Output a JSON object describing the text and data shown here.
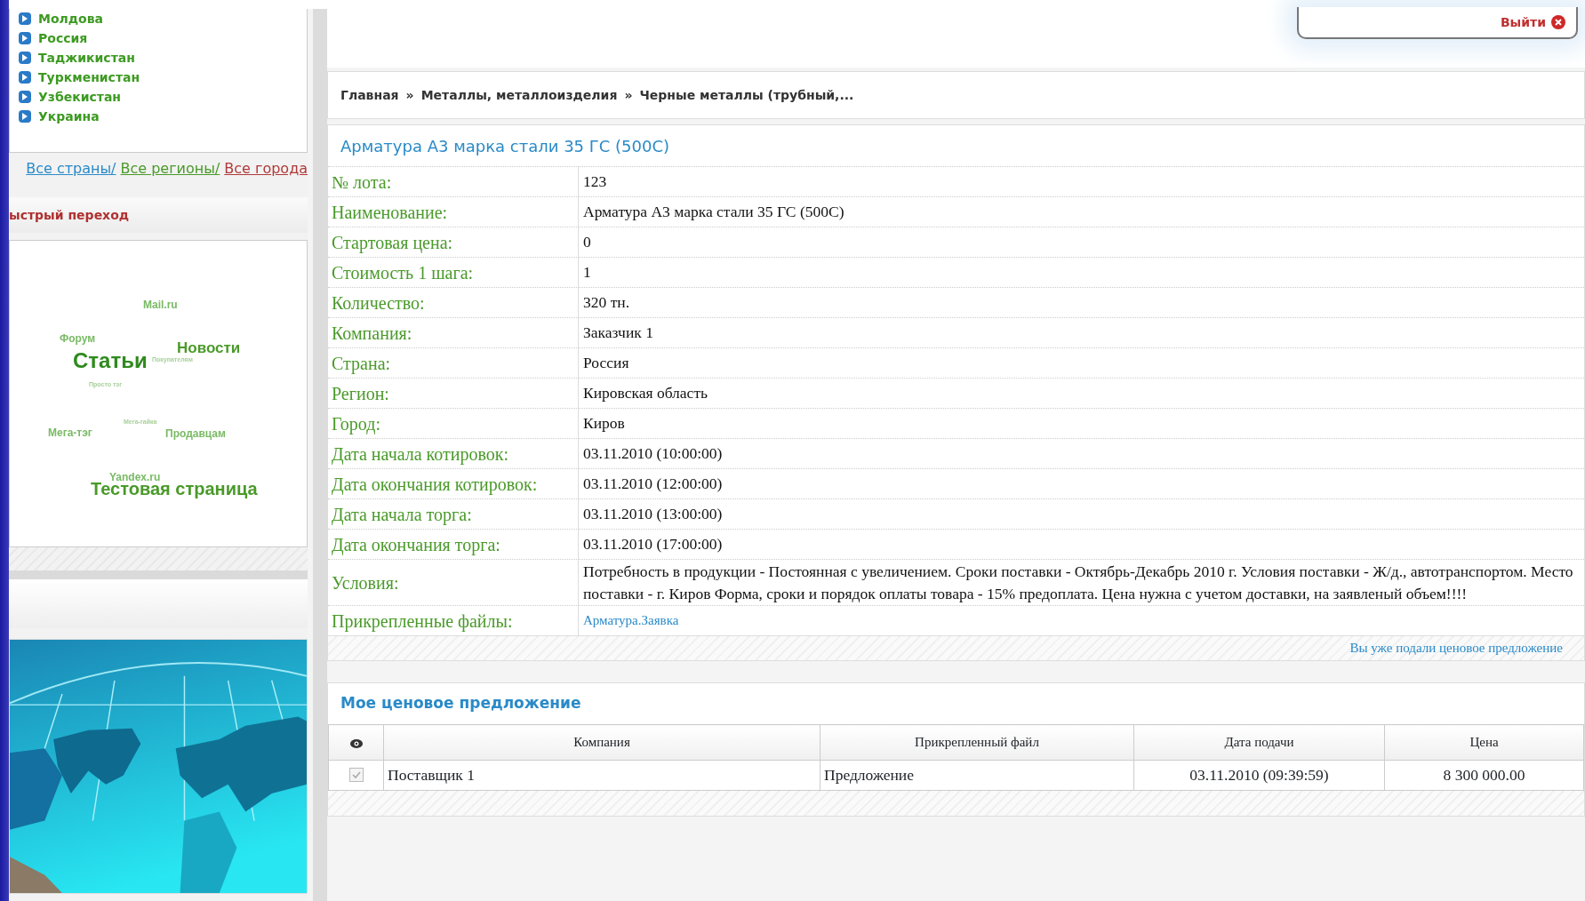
{
  "sidebar": {
    "countries": [
      "Молдова",
      "Россия",
      "Таджикистан",
      "Туркменистан",
      "Узбекистан",
      "Украина"
    ],
    "links": [
      {
        "label": "Все страны/",
        "color": "#2a8ac8"
      },
      {
        "label": "Все регионы/",
        "color": "#4a9a2a"
      },
      {
        "label": "Все города",
        "color": "#b03a3a"
      }
    ],
    "quick_nav": {
      "title": "ыстрый переход"
    },
    "tags": [
      {
        "label": "Mail.ru",
        "kind": "s"
      },
      {
        "label": "Форум",
        "kind": "s"
      },
      {
        "label": "Статьи",
        "kind": "xl"
      },
      {
        "label": "Покупателям",
        "kind": "xs"
      },
      {
        "label": "Новости",
        "kind": "m"
      },
      {
        "label": "Просто тэг",
        "kind": "xs"
      },
      {
        "label": "Мега-гайка",
        "kind": "xs"
      },
      {
        "label": "Мега-тэг",
        "kind": "s"
      },
      {
        "label": "Продавцам",
        "kind": "s"
      },
      {
        "label": "Yandex.ru",
        "kind": "s"
      },
      {
        "label": "Тестовая страница",
        "kind": "l"
      }
    ]
  },
  "header": {
    "logout": "Выйти"
  },
  "breadcrumbs": {
    "separator": "»",
    "items": [
      "Главная",
      "Металлы, металлоизделия",
      "Черные металлы (трубный,..."
    ]
  },
  "lot": {
    "title": "Арматура А3 марка стали 35 ГС (500С)",
    "rows": [
      {
        "label": "№ лота:",
        "value": "123",
        "kind": "text"
      },
      {
        "label": "Наименование:",
        "value": "Арматура А3 марка стали 35 ГС (500С)",
        "kind": "text"
      },
      {
        "label": "Стартовая цена:",
        "value": "0",
        "kind": "text"
      },
      {
        "label": "Стоимость 1 шага:",
        "value": "1",
        "kind": "text"
      },
      {
        "label": "Количество:",
        "value": "320 тн.",
        "kind": "text"
      },
      {
        "label": "Компания:",
        "value": "Заказчик 1",
        "kind": "text"
      },
      {
        "label": "Страна:",
        "value": "Россия",
        "kind": "text"
      },
      {
        "label": "Регион:",
        "value": "Кировская область",
        "kind": "text"
      },
      {
        "label": "Город:",
        "value": "Киров",
        "kind": "text"
      },
      {
        "label": "Дата начала котировок:",
        "value": "03.11.2010 (10:00:00)",
        "kind": "text"
      },
      {
        "label": "Дата окончания котировок:",
        "value": "03.11.2010 (12:00:00)",
        "kind": "text"
      },
      {
        "label": "Дата начала торга:",
        "value": "03.11.2010 (13:00:00)",
        "kind": "text"
      },
      {
        "label": "Дата окончания торга:",
        "value": "03.11.2010 (17:00:00)",
        "kind": "text"
      },
      {
        "label": "Условия:",
        "value": "Потребность в продукции - Постоянная с увеличением. Сроки поставки - Октябрь-Декабрь 2010 г. Условия поставки - Ж/д., автотранспортом. Место поставки - г. Киров Форма, сроки и порядок оплаты товара - 15% предоплата. Цена нужна с учетом доставки, на заявленый объем!!!!",
        "kind": "text"
      },
      {
        "label": "Прикрепленные файлы:",
        "value": "Арматура.Заявка",
        "kind": "link"
      }
    ],
    "notice": "Вы уже подали ценовое предложение"
  },
  "offers": {
    "title": "Мое ценовое предложение",
    "columns": [
      "Компания",
      "Прикрепленный файл",
      "Дата подачи",
      "Цена"
    ],
    "rows": [
      {
        "checked": true,
        "company": "Поставщик 1",
        "file": "Предложение",
        "date": "03.11.2010 (09:39:59)",
        "price": "8 300 000.00"
      }
    ]
  }
}
